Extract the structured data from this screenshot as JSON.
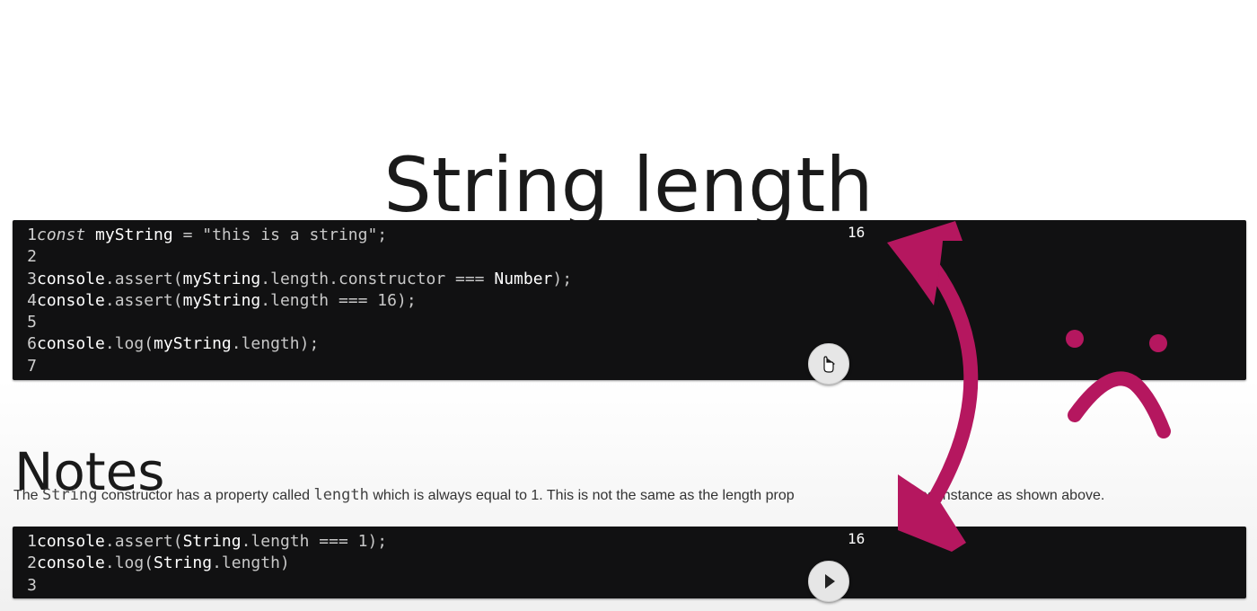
{
  "title": "String length",
  "editor1": {
    "output": "16",
    "lines": [
      {
        "num": "1",
        "tokens": [
          {
            "t": "const",
            "c": "k"
          },
          {
            "t": " ",
            "c": "p"
          },
          {
            "t": "myString",
            "c": "id"
          },
          {
            "t": " = \"this is a string\";",
            "c": "p"
          }
        ]
      },
      {
        "num": "2",
        "tokens": []
      },
      {
        "num": "3",
        "tokens": [
          {
            "t": "console",
            "c": "id"
          },
          {
            "t": ".assert(",
            "c": "p"
          },
          {
            "t": "myString",
            "c": "id"
          },
          {
            "t": ".length.constructor === ",
            "c": "p"
          },
          {
            "t": "Number",
            "c": "id"
          },
          {
            "t": ");",
            "c": "p"
          }
        ]
      },
      {
        "num": "4",
        "tokens": [
          {
            "t": "console",
            "c": "id"
          },
          {
            "t": ".assert(",
            "c": "p"
          },
          {
            "t": "myString",
            "c": "id"
          },
          {
            "t": ".length === 16);",
            "c": "p"
          }
        ]
      },
      {
        "num": "5",
        "tokens": []
      },
      {
        "num": "6",
        "tokens": [
          {
            "t": "console",
            "c": "id"
          },
          {
            "t": ".log(",
            "c": "p"
          },
          {
            "t": "myString",
            "c": "id"
          },
          {
            "t": ".length);",
            "c": "p"
          }
        ]
      },
      {
        "num": "7",
        "tokens": []
      }
    ]
  },
  "notes": {
    "heading": "Notes",
    "text_parts": [
      {
        "t": "The ",
        "mono": false
      },
      {
        "t": "String",
        "mono": true
      },
      {
        "t": " constructor has a property called ",
        "mono": false
      },
      {
        "t": "length",
        "mono": true
      },
      {
        "t": " which is always equal to 1. This is not the same as the length prop",
        "mono": false
      },
      {
        "t": "string instance as shown above.",
        "mono": false,
        "gap": true
      }
    ]
  },
  "editor2": {
    "output": "16",
    "lines": [
      {
        "num": "1",
        "tokens": [
          {
            "t": "console",
            "c": "id"
          },
          {
            "t": ".assert(",
            "c": "p"
          },
          {
            "t": "String",
            "c": "id"
          },
          {
            "t": ".length === 1);",
            "c": "p"
          }
        ]
      },
      {
        "num": "2",
        "tokens": [
          {
            "t": "console",
            "c": "id"
          },
          {
            "t": ".log(",
            "c": "p"
          },
          {
            "t": "String",
            "c": "id"
          },
          {
            "t": ".length)",
            "c": "p"
          }
        ]
      },
      {
        "num": "3",
        "tokens": []
      }
    ]
  },
  "icons": {
    "run_button": "play-icon",
    "cursor": "hand-pointer-icon",
    "annotation_arrow": "double-arrow-icon",
    "annotation_face": "sad-face-icon"
  },
  "colors": {
    "editor_bg": "#111112",
    "annotation": "#b5175f"
  }
}
